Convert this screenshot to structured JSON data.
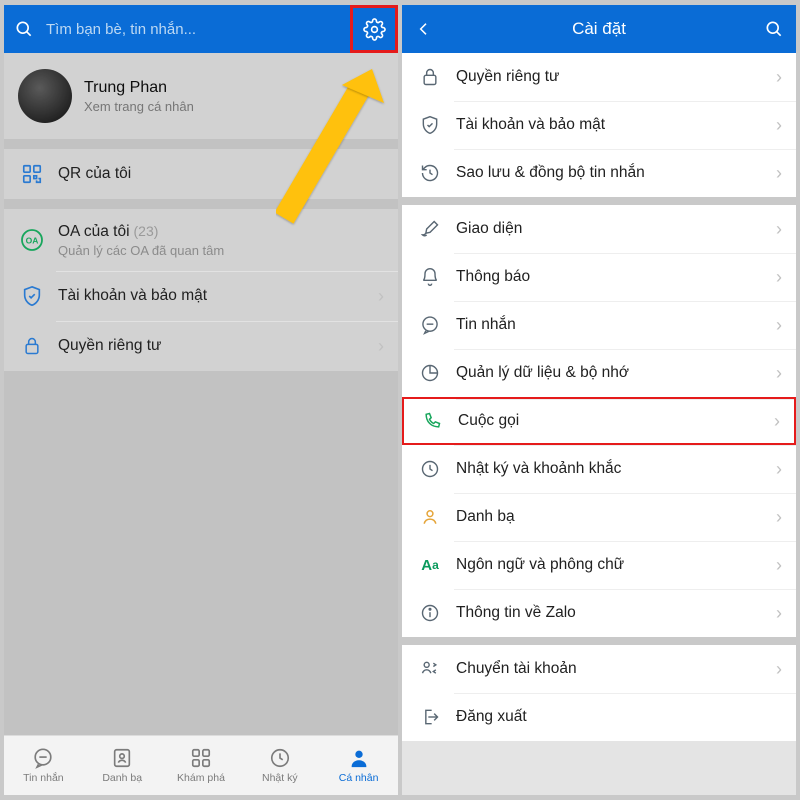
{
  "left": {
    "search_placeholder": "Tìm bạn bè, tin nhắn...",
    "profile": {
      "name": "Trung Phan",
      "subtitle": "Xem trang cá nhân"
    },
    "qr": "QR của tôi",
    "oa": {
      "title": "OA của tôi",
      "count": "(23)",
      "subtitle": "Quản lý các OA đã quan tâm"
    },
    "account": "Tài khoản và bảo mật",
    "privacy": "Quyền riêng tư",
    "tabs": {
      "messages": "Tin nhắn",
      "contacts": "Danh bạ",
      "discover": "Khám phá",
      "diary": "Nhật ký",
      "personal": "Cá nhân"
    }
  },
  "right": {
    "title": "Cài đặt",
    "items": {
      "privacy": "Quyền riêng tư",
      "account": "Tài khoản và bảo mật",
      "backup": "Sao lưu & đồng bộ tin nhắn",
      "interface": "Giao diện",
      "notify": "Thông báo",
      "message": "Tin nhắn",
      "storage": "Quản lý dữ liệu & bộ nhớ",
      "call": "Cuộc gọi",
      "diary": "Nhật ký và khoảnh khắc",
      "contacts": "Danh bạ",
      "lang": "Ngôn ngữ và phông chữ",
      "about": "Thông tin về Zalo",
      "switch": "Chuyển tài khoản",
      "logout": "Đăng xuất"
    }
  }
}
